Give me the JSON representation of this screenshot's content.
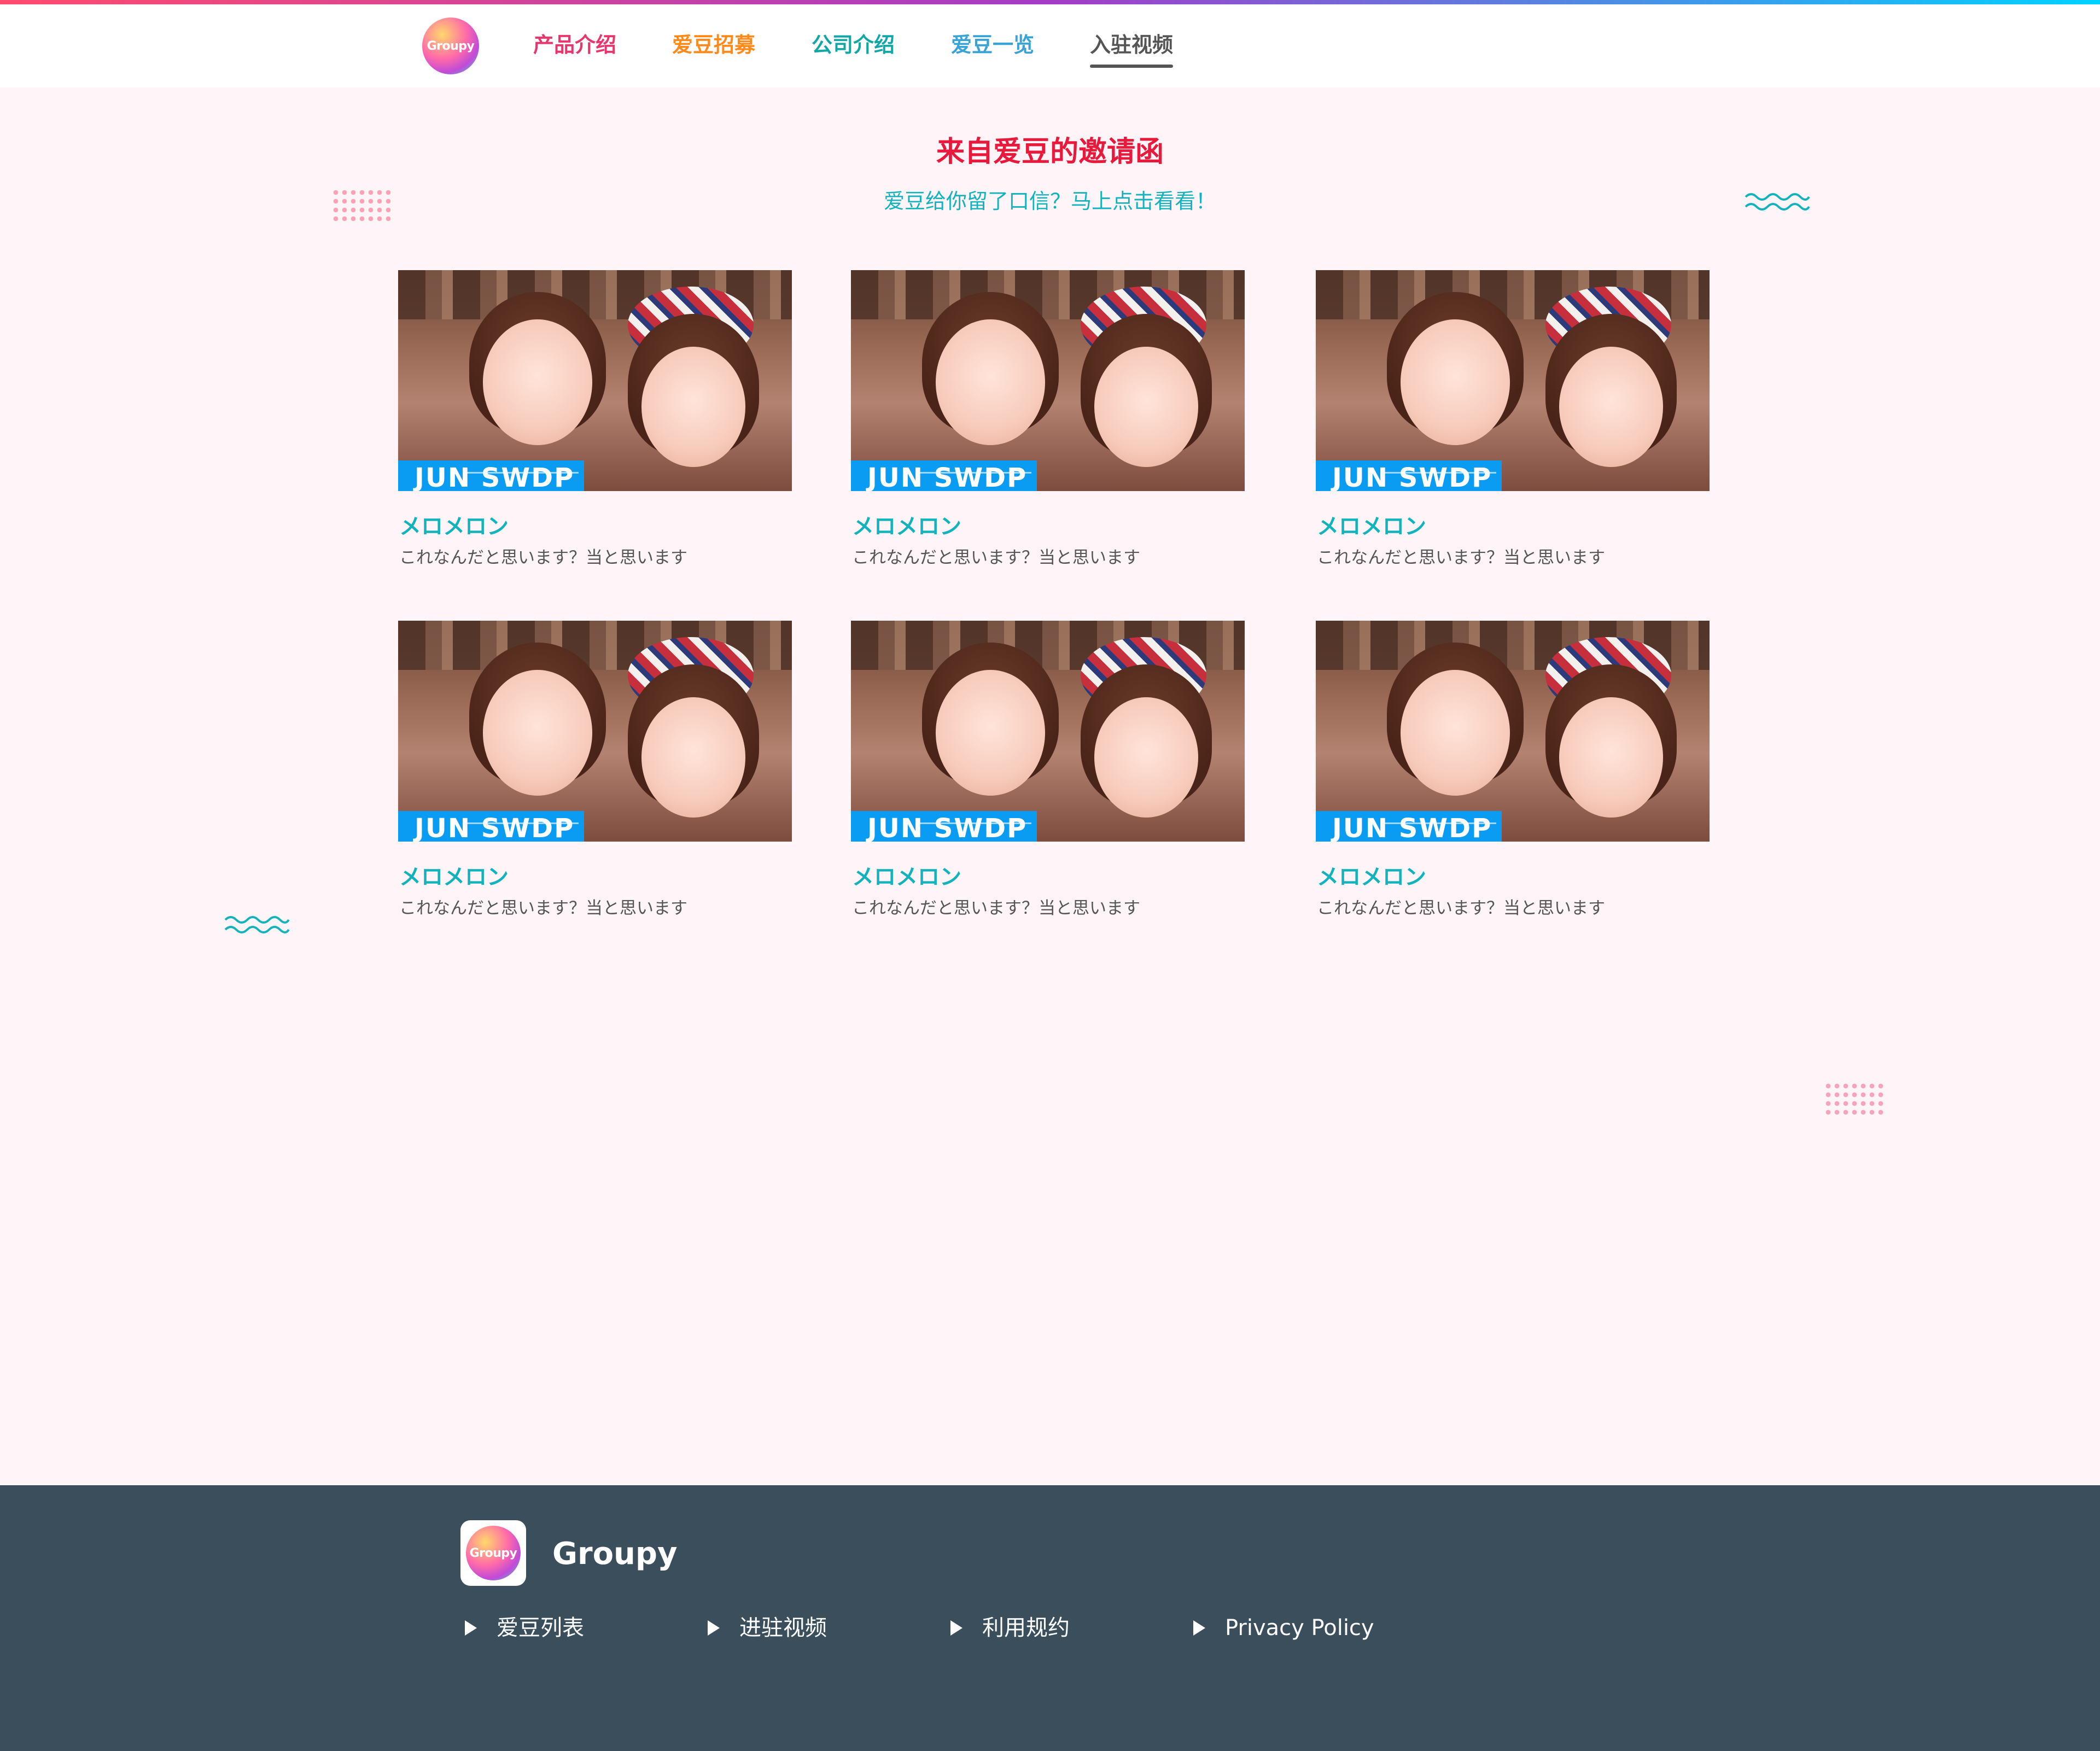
{
  "logo": {
    "text": "Groupy"
  },
  "nav": [
    {
      "label": "产品介绍",
      "color": "#e8356c"
    },
    {
      "label": "爱豆招募",
      "color": "#ff8a1a"
    },
    {
      "label": "公司介绍",
      "color": "#12a7a7"
    },
    {
      "label": "爱豆一览",
      "color": "#3aa3d6"
    },
    {
      "label": "入驻视频",
      "color": "#555555",
      "active": true
    }
  ],
  "section": {
    "title": "来自爱豆的邀请函",
    "subtitle": "爱豆给你留了口信？马上点击看看！"
  },
  "cards": [
    {
      "title": "メロメロン",
      "desc": "これなんだと思います？当と思います",
      "caption": "JUN SWDP"
    },
    {
      "title": "メロメロン",
      "desc": "これなんだと思います？当と思います",
      "caption": "JUN SWDP"
    },
    {
      "title": "メロメロン",
      "desc": "これなんだと思います？当と思います",
      "caption": "JUN SWDP"
    },
    {
      "title": "メロメロン",
      "desc": "これなんだと思います？当と思います",
      "caption": "JUN SWDP"
    },
    {
      "title": "メロメロン",
      "desc": "これなんだと思います？当と思います",
      "caption": "JUN SWDP"
    },
    {
      "title": "メロメロン",
      "desc": "これなんだと思います？当と思います",
      "caption": "JUN SWDP"
    }
  ],
  "footer": {
    "brand": "Groupy",
    "logo_text": "Groupy",
    "links": [
      {
        "label": "爱豆列表"
      },
      {
        "label": "进驻视频"
      },
      {
        "label": "利用规约"
      },
      {
        "label": "Privacy Policy"
      }
    ]
  },
  "colors": {
    "page_bg": "#fff4f7",
    "accent_teal": "#12b3bd",
    "title_red": "#e8193a",
    "footer_bg": "#3a4f5b",
    "caption_blue": "#0a9bf3"
  },
  "icons": {
    "nav_bullet": "triangle-right-icon",
    "decoration_dots": "dot-grid-icon",
    "decoration_wave": "wave-icon"
  }
}
